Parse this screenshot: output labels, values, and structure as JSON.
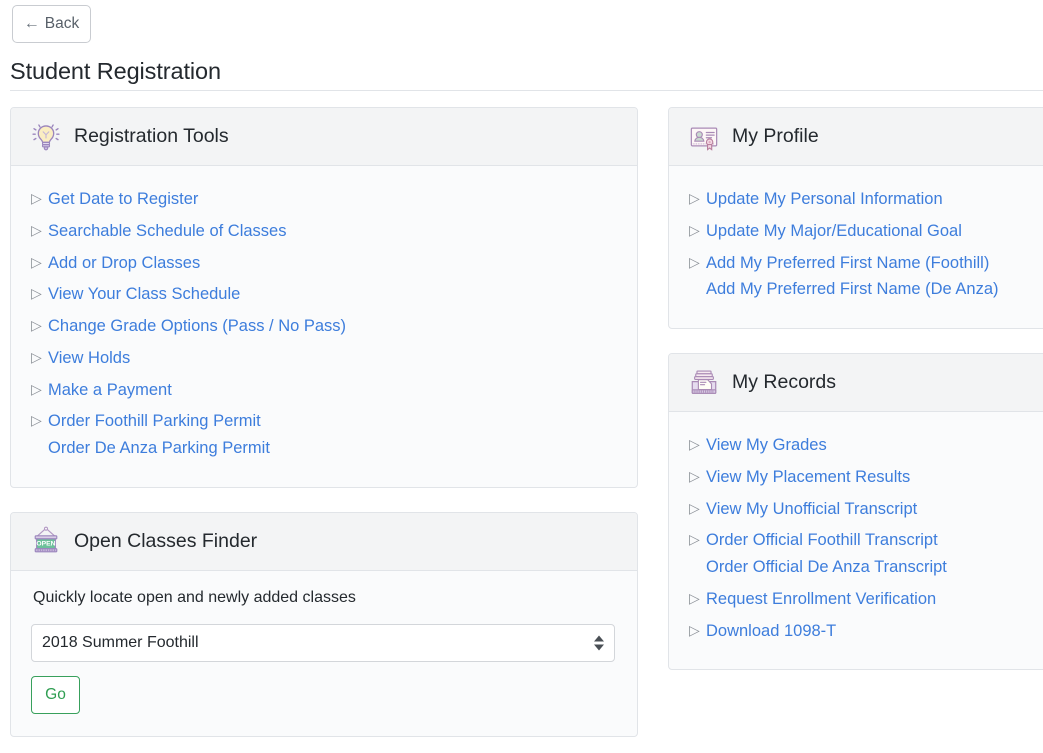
{
  "nav": {
    "back_label": "Back",
    "back_icon": "left-arrow-icon"
  },
  "page_title": "Student Registration",
  "cards": {
    "registration_tools": {
      "title": "Registration Tools",
      "icon": "lightbulb-icon",
      "links": [
        {
          "label": "Get Date to Register",
          "bullet": true
        },
        {
          "label": "Searchable Schedule of Classes",
          "bullet": true
        },
        {
          "label": "Add or Drop Classes",
          "bullet": true
        },
        {
          "label": "View Your Class Schedule",
          "bullet": true
        },
        {
          "label": "Change Grade Options (Pass / No Pass)",
          "bullet": true
        },
        {
          "label": "View Holds",
          "bullet": true
        },
        {
          "label": "Make a Payment",
          "bullet": true
        },
        {
          "label": "Order Foothill Parking Permit",
          "bullet": true
        },
        {
          "label": "Order De Anza Parking Permit",
          "bullet": false
        }
      ]
    },
    "open_classes_finder": {
      "title": "Open Classes Finder",
      "icon": "open-sign-icon",
      "hint": "Quickly locate open and newly added classes",
      "term_select": {
        "value": "2018 Summer Foothill",
        "options": [
          "2018 Summer Foothill"
        ]
      },
      "go_label": "Go"
    },
    "my_profile": {
      "title": "My Profile",
      "icon": "id-card-icon",
      "links": [
        {
          "label": "Update My Personal Information",
          "bullet": true
        },
        {
          "label": "Update My Major/Educational Goal",
          "bullet": true
        },
        {
          "label": "Add My Preferred First Name (Foothill)",
          "bullet": true
        },
        {
          "label": "Add My Preferred First Name (De Anza)",
          "bullet": false
        }
      ]
    },
    "my_records": {
      "title": "My Records",
      "icon": "file-tray-icon",
      "links": [
        {
          "label": "View My Grades",
          "bullet": true
        },
        {
          "label": "View My Placement Results",
          "bullet": true
        },
        {
          "label": "View My Unofficial Transcript",
          "bullet": true
        },
        {
          "label": "Order Official Foothill Transcript",
          "bullet": true
        },
        {
          "label": "Order Official De Anza Transcript",
          "bullet": false
        },
        {
          "label": "Request Enrollment Verification",
          "bullet": true
        },
        {
          "label": "Download 1098-T",
          "bullet": true
        }
      ]
    }
  },
  "colors": {
    "link": "#3d7ddc",
    "card_header_bg": "#f3f4f5",
    "card_body_bg": "#fafbfc",
    "card_border": "#e1e4e8",
    "go_button": "#2f9e52",
    "title_text": "#24292e",
    "bullet": "#8b9097"
  }
}
